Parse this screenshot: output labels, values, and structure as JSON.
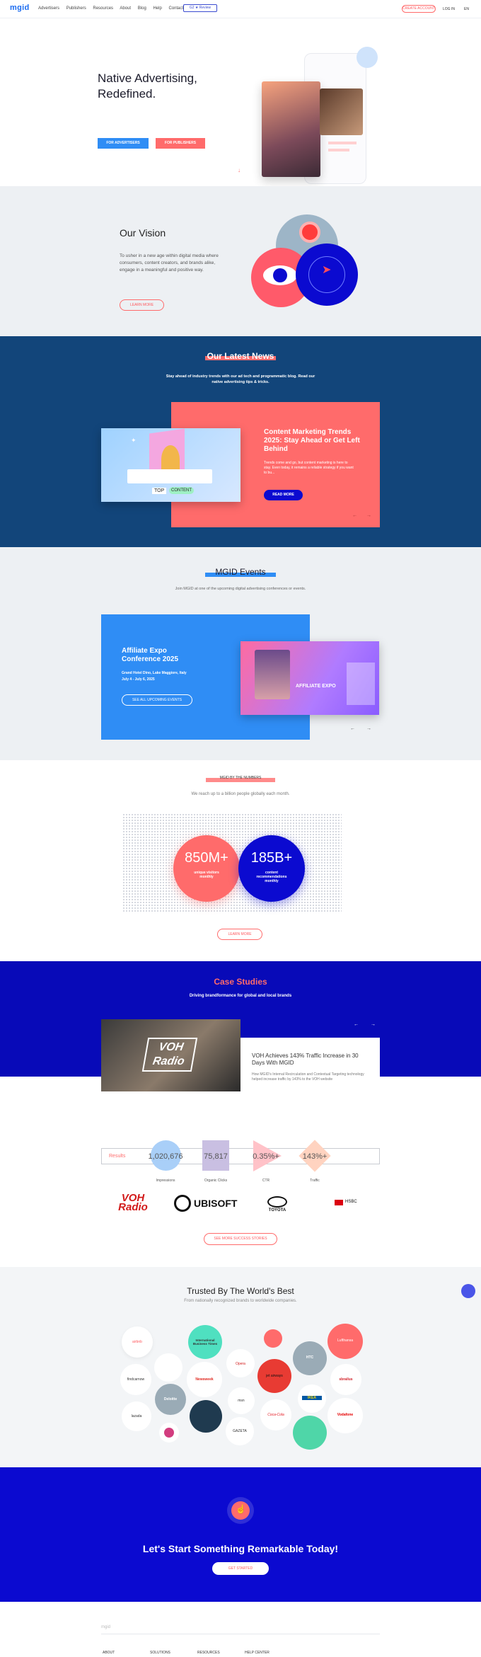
{
  "colors": {
    "accent": "#ff6b6b",
    "blue": "#2f8df5",
    "navy": "#12457a",
    "ultramarine": "#0b0ad0"
  },
  "nav": {
    "logo": "mgid",
    "links": [
      "Advertisers",
      "Publishers",
      "Resources",
      "About",
      "Blog",
      "Help",
      "Contact"
    ],
    "review_badge": "G2 ★ Review",
    "signup": "CREATE ACCOUNT",
    "login": "LOG IN",
    "lang": "EN"
  },
  "hero": {
    "title": "Native Advertising, Redefined.",
    "btn_advertisers": "FOR ADVERTISERS",
    "btn_publishers": "FOR PUBLISHERS"
  },
  "vision": {
    "title": "Our Vision",
    "text": "To usher in a new age within digital media where consumers, content creators, and brands alike, engage in a meaningful and positive way.",
    "button": "LEARN MORE"
  },
  "news": {
    "title": "Our Latest News",
    "subtitle": "Stay ahead of industry trends with our ad tech and programmatic blog. Read our native advertising tips & tricks.",
    "card_title": "Content Marketing Trends 2025: Stay Ahead or Get Left Behind",
    "card_text": "Trends come and go, but content marketing is here to stay. Even today, it remains a reliable strategy if you want to bu...",
    "button": "READ MORE",
    "image_tags": [
      "TOP",
      "CONTENT"
    ]
  },
  "events": {
    "title": "MGID Events",
    "subtitle": "Join MGID at one of the upcoming digital advertising conferences or events.",
    "event_title": "Affiliate Expo Conference 2025",
    "event_place": "Grand Hotel Dino, Lake Maggiore, Italy",
    "event_dates": "July 4 - July 6, 2025",
    "button": "SEE ALL UPCOMING EVENTS",
    "image_label": "AFFILIATE EXPO"
  },
  "reach": {
    "kicker": "MGID BY THE NUMBERS",
    "subtitle": "We reach up to a billion people globally each month.",
    "stat1_value": "850M+",
    "stat1_label": "unique visitors monthly",
    "stat2_value": "185B+",
    "stat2_label": "content recommendations monthly",
    "button": "LEARN MORE"
  },
  "cases": {
    "title": "Case Studies",
    "subtitle": "Driving brandformance for global and local brands",
    "card_title": "VOH Achieves 143% Traffic Increase in 30 Days With MGID",
    "card_text": "How MGID's Internal Recirculation and Contextual Targeting technology helped increase traffic by 143% to the VOH website",
    "image_label": "VOH Radio",
    "results_label": "Results",
    "metrics": [
      {
        "value": "1,020,676",
        "label": "Impressions"
      },
      {
        "value": "75,817",
        "label": "Organic Clicks"
      },
      {
        "value": "0.35%+",
        "label": "CTR"
      },
      {
        "value": "143%+",
        "label": "Traffic"
      }
    ],
    "brands": [
      "VOH Radio",
      "UBISOFT",
      "TOYOTA",
      "HSBC"
    ],
    "button": "SEE MORE SUCCESS STORIES"
  },
  "trusted": {
    "title": "Trusted By The World's Best",
    "subtitle": "From nationally recognized brands to worldwide companies.",
    "logos": [
      "airbnb",
      "International Business Times",
      "Opera",
      "HTC",
      "Lufthansa",
      "findcarnow",
      "Newsweek",
      "jet airways",
      "sbrailus",
      "Deloitte",
      "msn",
      "IKEA",
      "lazada",
      "Coca-Cola",
      "Vodafone",
      "GAZETA"
    ]
  },
  "cta": {
    "title": "Let's Start Something Remarkable Today!",
    "button": "GET STARTED"
  },
  "footer": {
    "cols": [
      "ABOUT",
      "SOLUTIONS",
      "RESOURCES",
      "HELP CENTER"
    ],
    "brand": "mgid"
  }
}
